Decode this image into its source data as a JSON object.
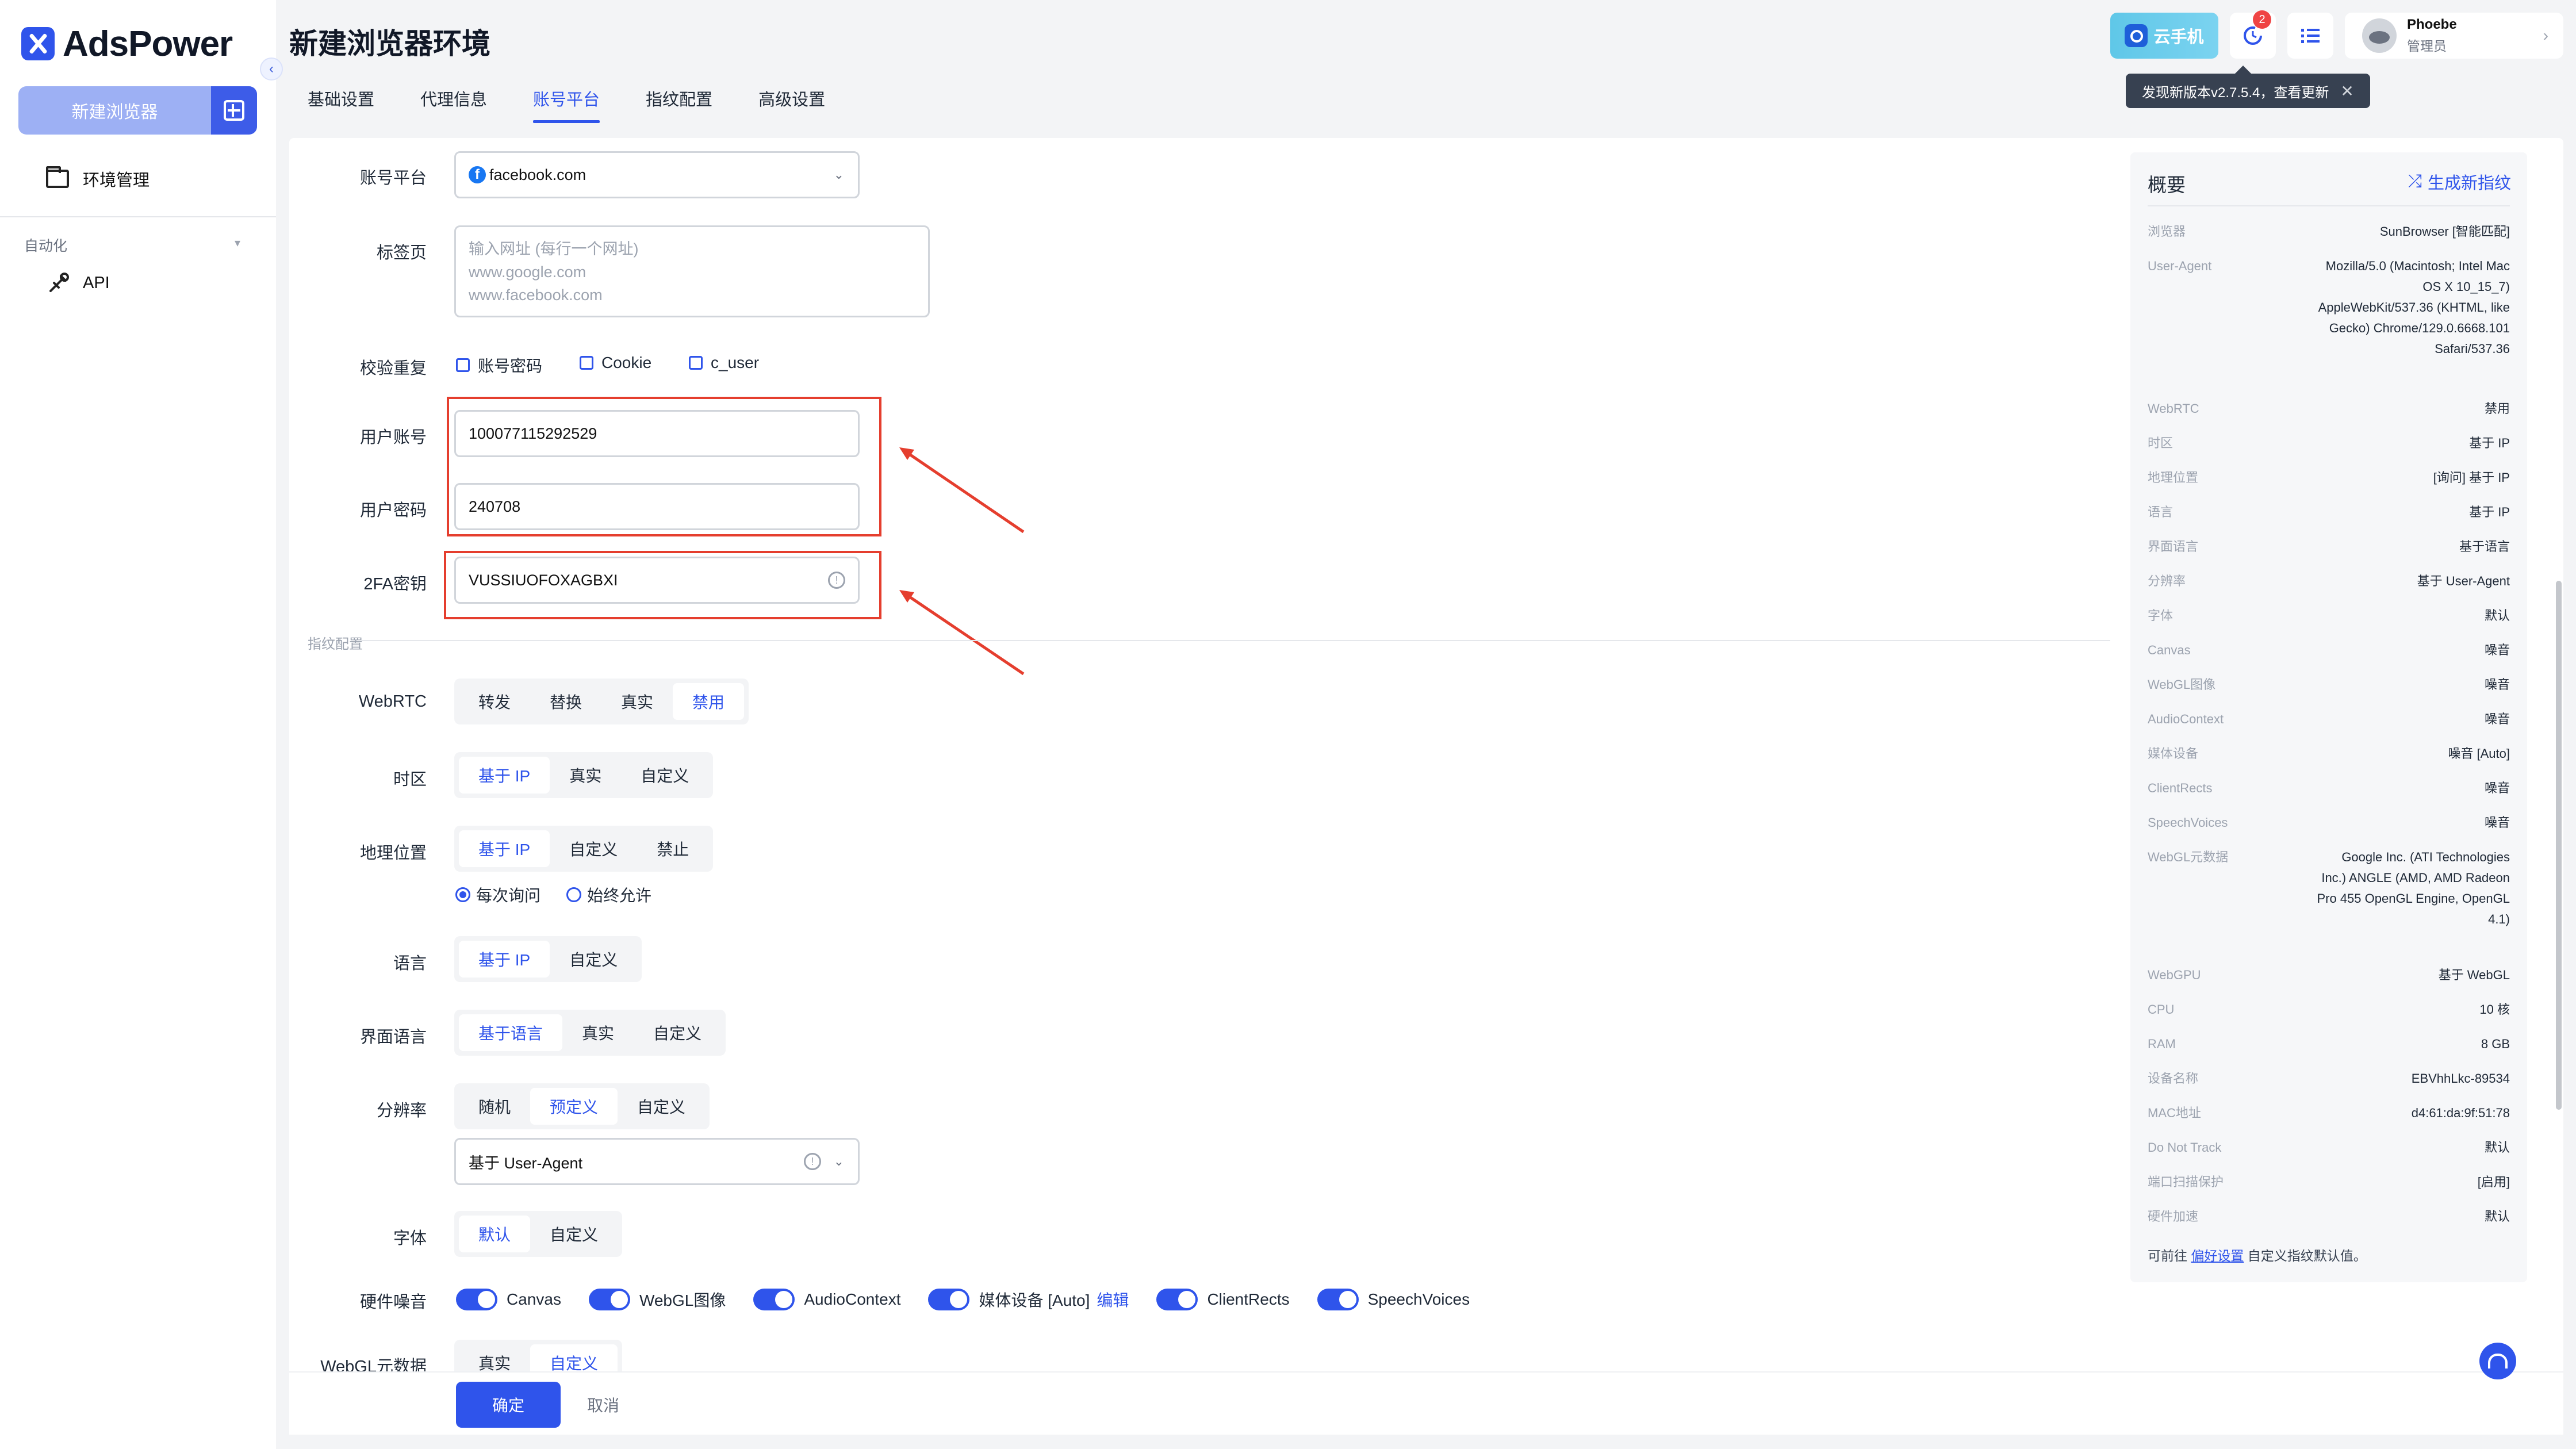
{
  "app": {
    "name": "AdsPower",
    "new_browser": "新建浏览器",
    "nav_env": "环境管理",
    "automation": "自动化",
    "nav_api": "API"
  },
  "page": {
    "title": "新建浏览器环境"
  },
  "tabs": [
    {
      "label": "基础设置"
    },
    {
      "label": "代理信息"
    },
    {
      "label": "账号平台",
      "active": true
    },
    {
      "label": "指纹配置"
    },
    {
      "label": "高级设置"
    }
  ],
  "header": {
    "cloud_phone": "云手机",
    "notif_count": "2",
    "user_name": "Phoebe",
    "user_role": "管理员",
    "update_tip": "发现新版本v2.7.5.4，查看更新"
  },
  "form": {
    "platform_label": "账号平台",
    "platform_value": "facebook.com",
    "tab_label": "标签页",
    "tab_placeholder_1": "输入网址 (每行一个网址)",
    "tab_placeholder_2": "www.google.com",
    "tab_placeholder_3": "www.facebook.com",
    "dedupe_label": "校验重复",
    "dedupe_opts": [
      "账号密码",
      "Cookie",
      "c_user"
    ],
    "user_label": "用户账号",
    "user_value": "100077115292529",
    "pass_label": "用户密码",
    "pass_value": "240708",
    "twofa_label": "2FA密钥",
    "twofa_value": "VUSSIUOFOXAGBXI"
  },
  "fingerprint": {
    "section": "指纹配置",
    "webrtc": {
      "label": "WebRTC",
      "opts": [
        "转发",
        "替换",
        "真实",
        "禁用"
      ],
      "selected": "禁用"
    },
    "timezone": {
      "label": "时区",
      "opts": [
        "基于 IP",
        "真实",
        "自定义"
      ],
      "selected": "基于 IP"
    },
    "geo": {
      "label": "地理位置",
      "opts": [
        "基于 IP",
        "自定义",
        "禁止"
      ],
      "selected": "基于 IP",
      "radio": [
        "每次询问",
        "始终允许"
      ],
      "radio_selected": "每次询问"
    },
    "language": {
      "label": "语言",
      "opts": [
        "基于 IP",
        "自定义"
      ],
      "selected": "基于 IP"
    },
    "ui_lang": {
      "label": "界面语言",
      "opts": [
        "基于语言",
        "真实",
        "自定义"
      ],
      "selected": "基于语言"
    },
    "resolution": {
      "label": "分辨率",
      "opts": [
        "随机",
        "预定义",
        "自定义"
      ],
      "selected": "预定义",
      "select_value": "基于 User-Agent"
    },
    "font": {
      "label": "字体",
      "opts": [
        "默认",
        "自定义"
      ],
      "selected": "默认"
    },
    "hw_noise": {
      "label": "硬件噪音",
      "items": [
        "Canvas",
        "WebGL图像",
        "AudioContext",
        "媒体设备 [Auto]",
        "ClientRects",
        "SpeechVoices"
      ],
      "edit": "编辑"
    },
    "webgl_meta": {
      "label": "WebGL元数据",
      "opts": [
        "真实",
        "自定义"
      ],
      "selected": "自定义"
    }
  },
  "footer": {
    "ok": "确定",
    "cancel": "取消"
  },
  "summary": {
    "title": "概要",
    "generate": "生成新指纹",
    "rows": [
      {
        "k": "浏览器",
        "v": "SunBrowser [智能匹配]"
      },
      {
        "k": "User-Agent",
        "v": "Mozilla/5.0 (Macintosh; Intel Mac OS X 10_15_7) AppleWebKit/537.36 (KHTML, like Gecko) Chrome/129.0.6668.101 Safari/537.36"
      },
      {
        "k": "WebRTC",
        "v": "禁用"
      },
      {
        "k": "时区",
        "v": "基于 IP"
      },
      {
        "k": "地理位置",
        "v": "[询问] 基于 IP"
      },
      {
        "k": "语言",
        "v": "基于 IP"
      },
      {
        "k": "界面语言",
        "v": "基于语言"
      },
      {
        "k": "分辨率",
        "v": "基于 User-Agent"
      },
      {
        "k": "字体",
        "v": "默认"
      },
      {
        "k": "Canvas",
        "v": "噪音"
      },
      {
        "k": "WebGL图像",
        "v": "噪音"
      },
      {
        "k": "AudioContext",
        "v": "噪音"
      },
      {
        "k": "媒体设备",
        "v": "噪音 [Auto]"
      },
      {
        "k": "ClientRects",
        "v": "噪音"
      },
      {
        "k": "SpeechVoices",
        "v": "噪音"
      },
      {
        "k": "WebGL元数据",
        "v": "Google Inc. (ATI Technologies Inc.) ANGLE (AMD, AMD Radeon Pro 455 OpenGL Engine, OpenGL 4.1)"
      },
      {
        "k": "WebGPU",
        "v": "基于 WebGL"
      },
      {
        "k": "CPU",
        "v": "10 核"
      },
      {
        "k": "RAM",
        "v": "8 GB"
      },
      {
        "k": "设备名称",
        "v": "EBVhhLkc-89534"
      },
      {
        "k": "MAC地址",
        "v": "d4:61:da:9f:51:78"
      },
      {
        "k": "Do Not Track",
        "v": "默认"
      },
      {
        "k": "端口扫描保护",
        "v": "[启用]"
      },
      {
        "k": "硬件加速",
        "v": "默认"
      }
    ],
    "foot_pre": "可前往",
    "foot_link": "偏好设置",
    "foot_post": "自定义指纹默认值。"
  },
  "colors": {
    "accent": "#2f54eb",
    "highlight": "#e53e2e"
  }
}
